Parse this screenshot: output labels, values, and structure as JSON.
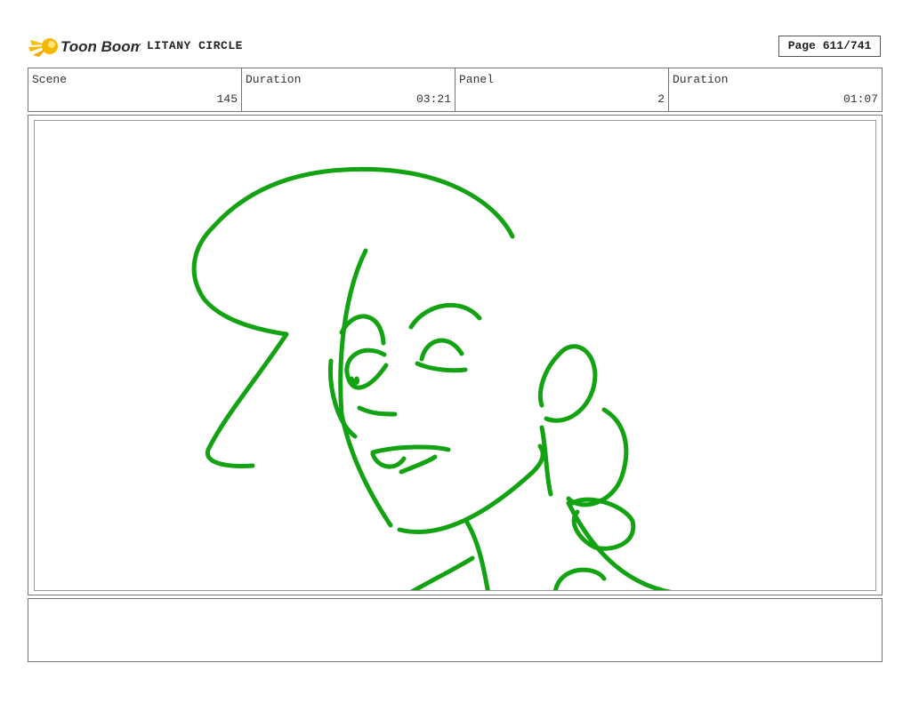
{
  "header": {
    "brand": "Toon Boom",
    "project_title": "LITANY CIRCLE",
    "page_counter": "Page 611/741"
  },
  "info": {
    "scene_label": "Scene",
    "scene_value": "145",
    "scene_duration_label": "Duration",
    "scene_duration_value": "03:21",
    "panel_label": "Panel",
    "panel_value": "2",
    "panel_duration_label": "Duration",
    "panel_duration_value": "01:07"
  },
  "panel": {
    "sketch_color": "#12a212",
    "notes": ""
  },
  "colors": {
    "logo_yellow": "#f5b800",
    "logo_text": "#2b2b2b",
    "frame_border": "#777777"
  },
  "icons": {
    "logo": "toon-boom-comet-icon"
  }
}
